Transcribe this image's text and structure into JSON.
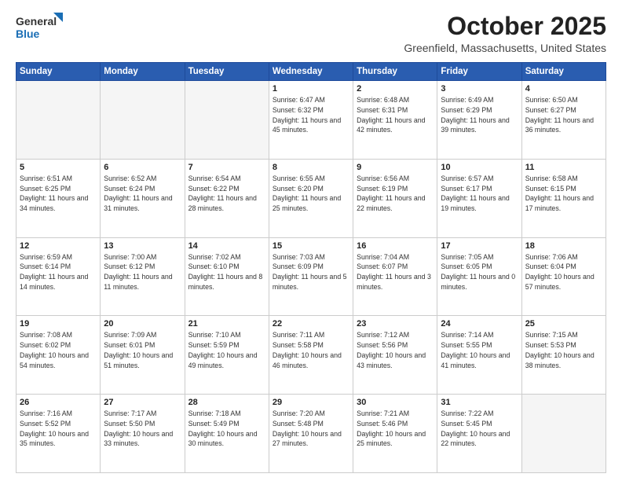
{
  "header": {
    "logo_general": "General",
    "logo_blue": "Blue",
    "title": "October 2025",
    "location": "Greenfield, Massachusetts, United States"
  },
  "weekdays": [
    "Sunday",
    "Monday",
    "Tuesday",
    "Wednesday",
    "Thursday",
    "Friday",
    "Saturday"
  ],
  "weeks": [
    [
      {
        "day": "",
        "info": ""
      },
      {
        "day": "",
        "info": ""
      },
      {
        "day": "",
        "info": ""
      },
      {
        "day": "1",
        "info": "Sunrise: 6:47 AM\nSunset: 6:32 PM\nDaylight: 11 hours\nand 45 minutes."
      },
      {
        "day": "2",
        "info": "Sunrise: 6:48 AM\nSunset: 6:31 PM\nDaylight: 11 hours\nand 42 minutes."
      },
      {
        "day": "3",
        "info": "Sunrise: 6:49 AM\nSunset: 6:29 PM\nDaylight: 11 hours\nand 39 minutes."
      },
      {
        "day": "4",
        "info": "Sunrise: 6:50 AM\nSunset: 6:27 PM\nDaylight: 11 hours\nand 36 minutes."
      }
    ],
    [
      {
        "day": "5",
        "info": "Sunrise: 6:51 AM\nSunset: 6:25 PM\nDaylight: 11 hours\nand 34 minutes."
      },
      {
        "day": "6",
        "info": "Sunrise: 6:52 AM\nSunset: 6:24 PM\nDaylight: 11 hours\nand 31 minutes."
      },
      {
        "day": "7",
        "info": "Sunrise: 6:54 AM\nSunset: 6:22 PM\nDaylight: 11 hours\nand 28 minutes."
      },
      {
        "day": "8",
        "info": "Sunrise: 6:55 AM\nSunset: 6:20 PM\nDaylight: 11 hours\nand 25 minutes."
      },
      {
        "day": "9",
        "info": "Sunrise: 6:56 AM\nSunset: 6:19 PM\nDaylight: 11 hours\nand 22 minutes."
      },
      {
        "day": "10",
        "info": "Sunrise: 6:57 AM\nSunset: 6:17 PM\nDaylight: 11 hours\nand 19 minutes."
      },
      {
        "day": "11",
        "info": "Sunrise: 6:58 AM\nSunset: 6:15 PM\nDaylight: 11 hours\nand 17 minutes."
      }
    ],
    [
      {
        "day": "12",
        "info": "Sunrise: 6:59 AM\nSunset: 6:14 PM\nDaylight: 11 hours\nand 14 minutes."
      },
      {
        "day": "13",
        "info": "Sunrise: 7:00 AM\nSunset: 6:12 PM\nDaylight: 11 hours\nand 11 minutes."
      },
      {
        "day": "14",
        "info": "Sunrise: 7:02 AM\nSunset: 6:10 PM\nDaylight: 11 hours\nand 8 minutes."
      },
      {
        "day": "15",
        "info": "Sunrise: 7:03 AM\nSunset: 6:09 PM\nDaylight: 11 hours\nand 5 minutes."
      },
      {
        "day": "16",
        "info": "Sunrise: 7:04 AM\nSunset: 6:07 PM\nDaylight: 11 hours\nand 3 minutes."
      },
      {
        "day": "17",
        "info": "Sunrise: 7:05 AM\nSunset: 6:05 PM\nDaylight: 11 hours\nand 0 minutes."
      },
      {
        "day": "18",
        "info": "Sunrise: 7:06 AM\nSunset: 6:04 PM\nDaylight: 10 hours\nand 57 minutes."
      }
    ],
    [
      {
        "day": "19",
        "info": "Sunrise: 7:08 AM\nSunset: 6:02 PM\nDaylight: 10 hours\nand 54 minutes."
      },
      {
        "day": "20",
        "info": "Sunrise: 7:09 AM\nSunset: 6:01 PM\nDaylight: 10 hours\nand 51 minutes."
      },
      {
        "day": "21",
        "info": "Sunrise: 7:10 AM\nSunset: 5:59 PM\nDaylight: 10 hours\nand 49 minutes."
      },
      {
        "day": "22",
        "info": "Sunrise: 7:11 AM\nSunset: 5:58 PM\nDaylight: 10 hours\nand 46 minutes."
      },
      {
        "day": "23",
        "info": "Sunrise: 7:12 AM\nSunset: 5:56 PM\nDaylight: 10 hours\nand 43 minutes."
      },
      {
        "day": "24",
        "info": "Sunrise: 7:14 AM\nSunset: 5:55 PM\nDaylight: 10 hours\nand 41 minutes."
      },
      {
        "day": "25",
        "info": "Sunrise: 7:15 AM\nSunset: 5:53 PM\nDaylight: 10 hours\nand 38 minutes."
      }
    ],
    [
      {
        "day": "26",
        "info": "Sunrise: 7:16 AM\nSunset: 5:52 PM\nDaylight: 10 hours\nand 35 minutes."
      },
      {
        "day": "27",
        "info": "Sunrise: 7:17 AM\nSunset: 5:50 PM\nDaylight: 10 hours\nand 33 minutes."
      },
      {
        "day": "28",
        "info": "Sunrise: 7:18 AM\nSunset: 5:49 PM\nDaylight: 10 hours\nand 30 minutes."
      },
      {
        "day": "29",
        "info": "Sunrise: 7:20 AM\nSunset: 5:48 PM\nDaylight: 10 hours\nand 27 minutes."
      },
      {
        "day": "30",
        "info": "Sunrise: 7:21 AM\nSunset: 5:46 PM\nDaylight: 10 hours\nand 25 minutes."
      },
      {
        "day": "31",
        "info": "Sunrise: 7:22 AM\nSunset: 5:45 PM\nDaylight: 10 hours\nand 22 minutes."
      },
      {
        "day": "",
        "info": ""
      }
    ]
  ]
}
